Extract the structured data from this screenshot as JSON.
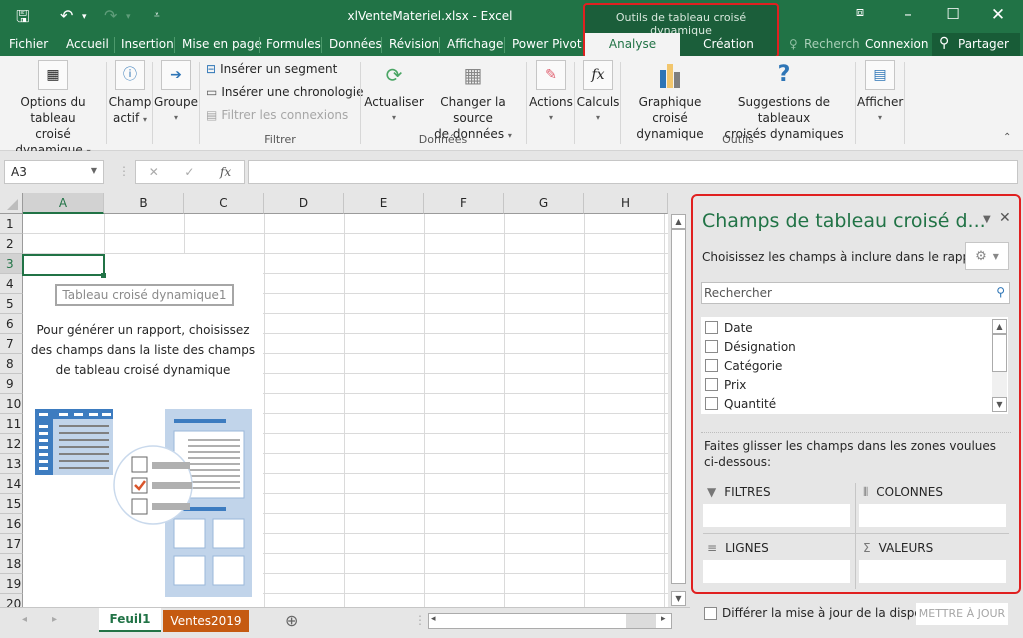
{
  "window": {
    "title": "xlVenteMateriel.xlsx - Excel",
    "context_group_title": "Outils de tableau croisé dynamique",
    "search_label": "Recherch",
    "signin_label": "Connexion",
    "share_label": "Partager"
  },
  "colors": {
    "excel_green": "#217346",
    "highlight_red": "#e02020",
    "sheet_tab_orange": "#c55a11",
    "pivot_blue": "#2e75b6"
  },
  "tabs": [
    {
      "label": "Fichier"
    },
    {
      "label": "Accueil"
    },
    {
      "label": "Insertion"
    },
    {
      "label": "Mise en page"
    },
    {
      "label": "Formules"
    },
    {
      "label": "Données"
    },
    {
      "label": "Révision"
    },
    {
      "label": "Affichage"
    },
    {
      "label": "Power Pivot"
    },
    {
      "label": "Analyse",
      "active": true
    },
    {
      "label": "Création"
    }
  ],
  "ribbon": {
    "options_l1": "Options du tableau",
    "options_l2": "croisé dynamique",
    "champ_l1": "Champ",
    "champ_l2": "actif",
    "groupe": "Groupe",
    "insert_segment": "Insérer un segment",
    "insert_timeline": "Insérer une chronologie",
    "filter_connections": "Filtrer les connexions",
    "group_filtrer": "Filtrer",
    "actualiser": "Actualiser",
    "change_source_l1": "Changer la source",
    "change_source_l2": "de données",
    "group_donnees": "Données",
    "actions": "Actions",
    "calculs": "Calculs",
    "pivotchart_l1": "Graphique croisé",
    "pivotchart_l2": "dynamique",
    "suggestions_l1": "Suggestions de tableaux",
    "suggestions_l2": "croisés dynamiques",
    "group_outils": "Outils",
    "afficher": "Afficher"
  },
  "formula_bar": {
    "name_box": "A3",
    "cancel": "✕",
    "enter": "✓",
    "fx": "fx",
    "value": ""
  },
  "grid": {
    "columns": [
      "A",
      "B",
      "C",
      "D",
      "E",
      "F",
      "G",
      "H"
    ],
    "rows": [
      "1",
      "2",
      "3",
      "4",
      "5",
      "6",
      "7",
      "8",
      "9",
      "10",
      "11",
      "12",
      "13",
      "14",
      "15",
      "16",
      "17",
      "18",
      "19",
      "20"
    ],
    "selected_cell": "A3"
  },
  "pivot_placeholder": {
    "name": "Tableau croisé dynamique1",
    "message_l1": "Pour générer un rapport, choisissez",
    "message_l2": "des champs dans la liste des champs",
    "message_l3": "de tableau croisé dynamique"
  },
  "sheets": [
    {
      "label": "Feuil1",
      "active": true
    },
    {
      "label": "Ventes2019",
      "active": false
    }
  ],
  "panel": {
    "title": "Champs de tableau croisé d...",
    "choose_label": "Choisissez les champs à inclure dans le rapport :",
    "search_placeholder": "Rechercher",
    "fields": [
      {
        "label": "Date",
        "checked": false
      },
      {
        "label": "Désignation",
        "checked": false
      },
      {
        "label": "Catégorie",
        "checked": false
      },
      {
        "label": "Prix",
        "checked": false
      },
      {
        "label": "Quantité",
        "checked": false
      }
    ],
    "drag_l1": "Faites glisser les champs dans les zones voulues",
    "drag_l2": "ci-dessous:",
    "zones": {
      "filters": "FILTRES",
      "columns": "COLONNES",
      "rows": "LIGNES",
      "values": "VALEURS"
    },
    "defer_label": "Différer la mise à jour de la dispo...",
    "update_button": "METTRE À JOUR"
  }
}
